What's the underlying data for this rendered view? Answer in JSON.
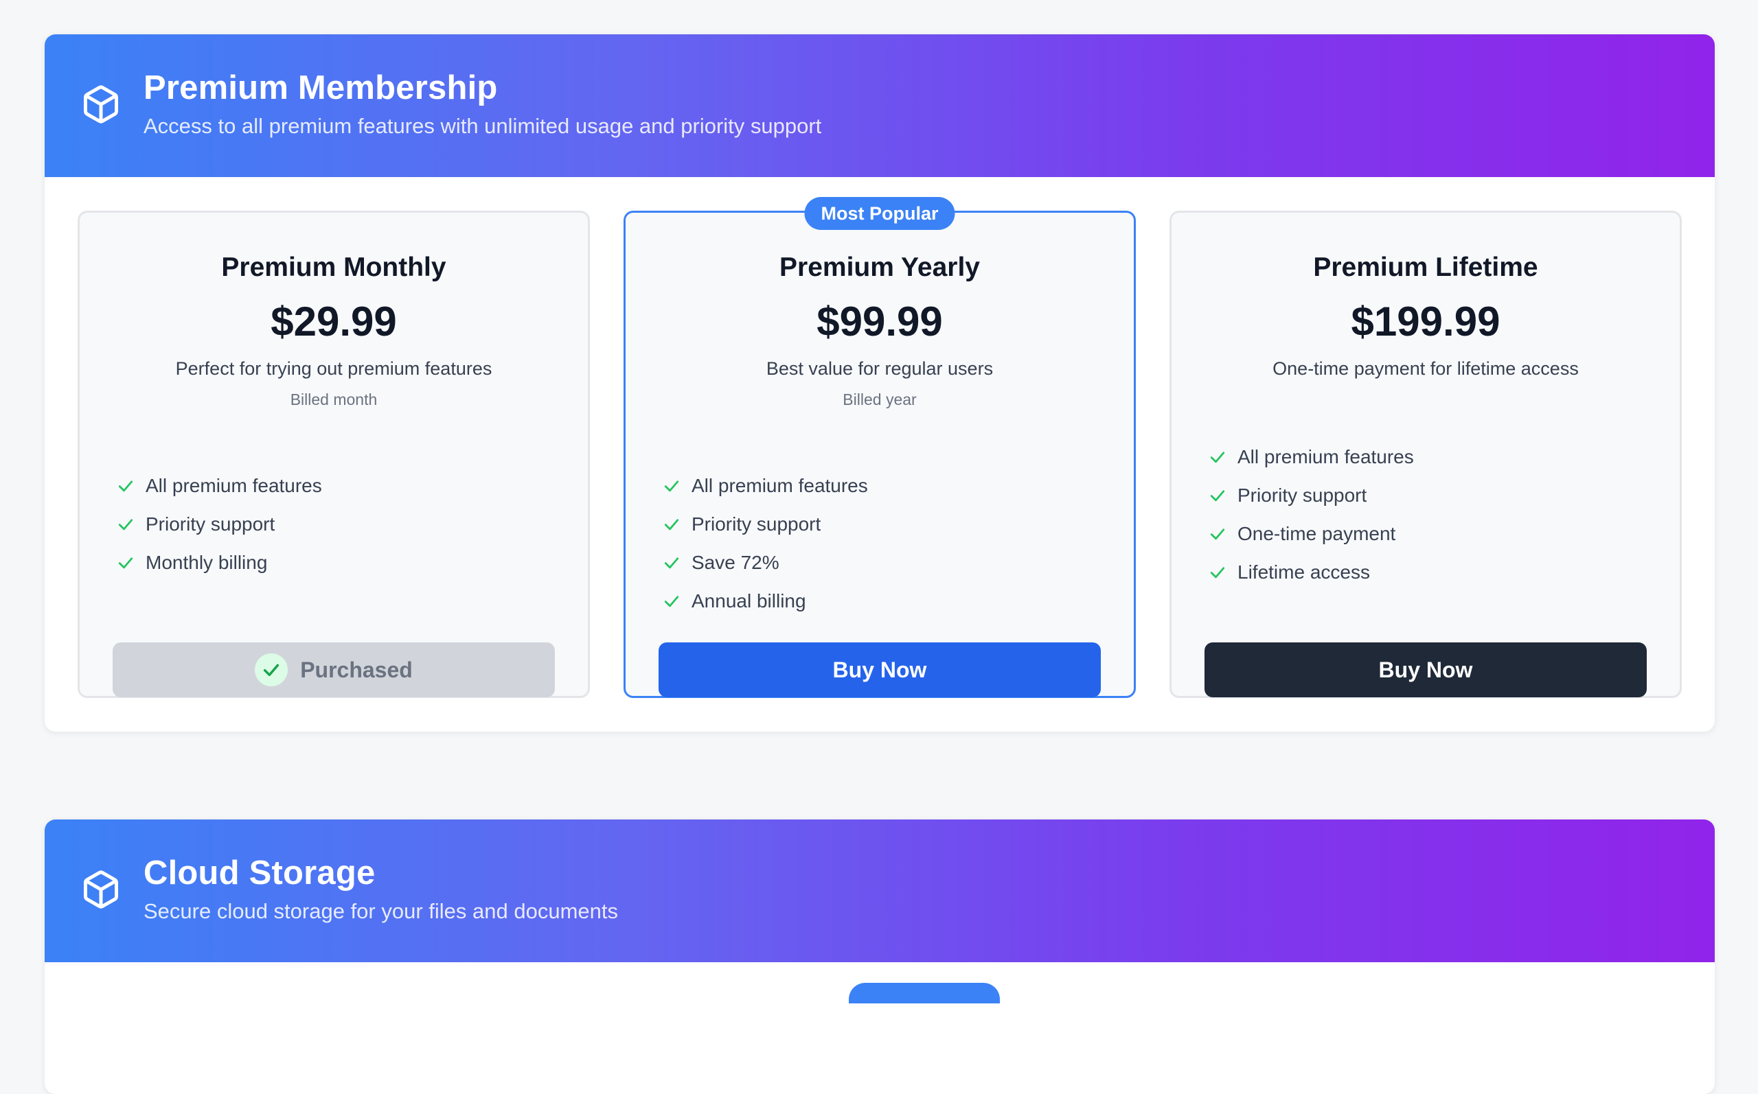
{
  "sections": [
    {
      "title": "Premium Membership",
      "subtitle": "Access to all premium features with unlimited usage and priority support",
      "plans": [
        {
          "name": "Premium Monthly",
          "price": "$29.99",
          "description": "Perfect for trying out premium features",
          "billed": "Billed month",
          "features": [
            "All premium features",
            "Priority support",
            "Monthly billing"
          ],
          "button_label": "Purchased"
        },
        {
          "badge": "Most Popular",
          "name": "Premium Yearly",
          "price": "$99.99",
          "description": "Best value for regular users",
          "billed": "Billed year",
          "features": [
            "All premium features",
            "Priority support",
            "Save 72%",
            "Annual billing"
          ],
          "button_label": "Buy Now"
        },
        {
          "name": "Premium Lifetime",
          "price": "$199.99",
          "description": "One-time payment for lifetime access",
          "features": [
            "All premium features",
            "Priority support",
            "One-time payment",
            "Lifetime access"
          ],
          "button_label": "Buy Now"
        }
      ]
    },
    {
      "title": "Cloud Storage",
      "subtitle": "Secure cloud storage for your files and documents"
    }
  ],
  "icons": {
    "section_icon": "cube-icon",
    "feature_icon": "check-icon",
    "purchased_icon": "check-circle-icon"
  },
  "colors": {
    "banner_gradient_start": "#3b82f6",
    "banner_gradient_end": "#9124ea",
    "popular_accent": "#3b82f6",
    "buy_primary": "#2563eb",
    "buy_dark": "#1f2937",
    "check_green": "#22c55e"
  }
}
